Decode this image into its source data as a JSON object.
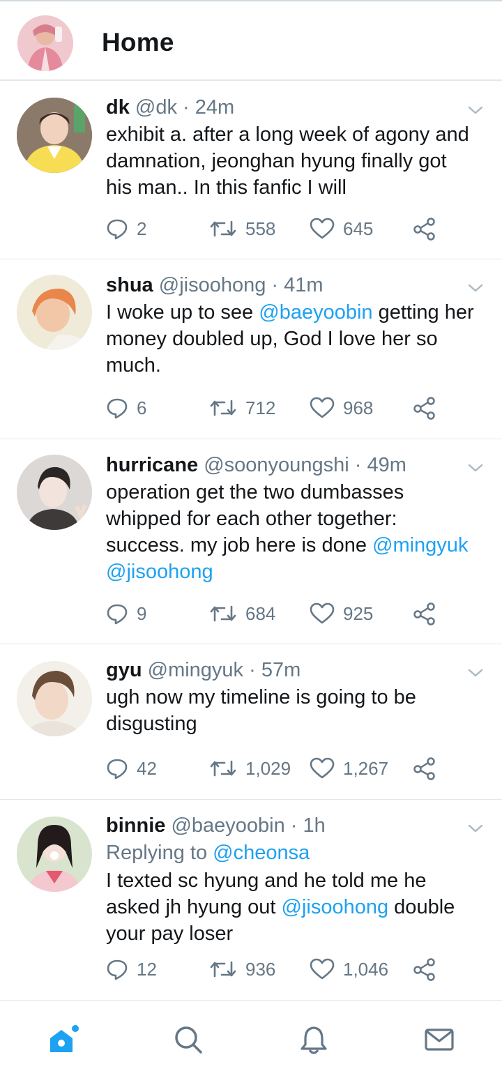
{
  "header": {
    "title": "Home",
    "avatar_icon": "profile-avatar-pink"
  },
  "colors": {
    "accent": "#1da1f2",
    "text": "#14171a",
    "muted": "#657786",
    "divider": "#e1e8ed"
  },
  "tweets": [
    {
      "name": "dk",
      "handle": "@dk",
      "time": "24m",
      "avatar": "avatar-yellow",
      "reply_to": null,
      "lines": [
        [
          {
            "t": "exhibit a. after a long week of agony and"
          }
        ],
        [
          {
            "t": "damnation, jeonghan hyung finally got"
          }
        ],
        [
          {
            "t": "his man.. In this fanfic I will"
          }
        ]
      ],
      "replies": "2",
      "retweets": "558",
      "likes": "645"
    },
    {
      "name": "shua",
      "handle": "@jisoohong",
      "time": "41m",
      "avatar": "avatar-orange",
      "reply_to": null,
      "lines": [
        [
          {
            "t": "I woke up to see "
          },
          {
            "t": "@baeyoobin",
            "m": true
          },
          {
            "t": " getting her"
          }
        ],
        [
          {
            "t": "money doubled up, God I love her so"
          }
        ],
        [
          {
            "t": "much."
          }
        ]
      ],
      "replies": "6",
      "retweets": "712",
      "likes": "968"
    },
    {
      "name": "hurricane",
      "handle": "@soonyoungshi",
      "time": "49m",
      "avatar": "avatar-grey",
      "reply_to": null,
      "lines": [
        [
          {
            "t": "operation get the two dumbasses"
          }
        ],
        [
          {
            "t": "whipped for each other together:"
          }
        ],
        [
          {
            "t": "success. my job here is done "
          },
          {
            "t": "@mingyuk",
            "m": true
          }
        ],
        [
          {
            "t": "@jisoohong",
            "m": true
          }
        ]
      ],
      "replies": "9",
      "retweets": "684",
      "likes": "925"
    },
    {
      "name": "gyu",
      "handle": "@mingyuk",
      "time": "57m",
      "avatar": "avatar-light",
      "reply_to": null,
      "lines": [
        [
          {
            "t": "ugh now my timeline is going to be"
          }
        ],
        [
          {
            "t": "disgusting"
          }
        ]
      ],
      "replies": "42",
      "retweets": "1,029",
      "likes": "1,267"
    },
    {
      "name": "binnie",
      "handle": "@baeyoobin",
      "time": "1h",
      "avatar": "avatar-girl",
      "reply_to": {
        "prefix": "Replying to ",
        "target": "@cheonsa"
      },
      "lines": [
        [
          {
            "t": "I texted sc hyung and he told me he"
          }
        ],
        [
          {
            "t": "asked jh hyung out "
          },
          {
            "t": "@jisoohong",
            "m": true
          },
          {
            "t": " double"
          }
        ],
        [
          {
            "t": "your pay loser"
          }
        ]
      ],
      "replies": "12",
      "retweets": "936",
      "likes": "1,046"
    }
  ],
  "tabbar": [
    {
      "name": "home-tab",
      "icon": "home-icon",
      "active": true
    },
    {
      "name": "search-tab",
      "icon": "search-icon",
      "active": false
    },
    {
      "name": "notifications-tab",
      "icon": "bell-icon",
      "active": false
    },
    {
      "name": "messages-tab",
      "icon": "mail-icon",
      "active": false
    }
  ]
}
